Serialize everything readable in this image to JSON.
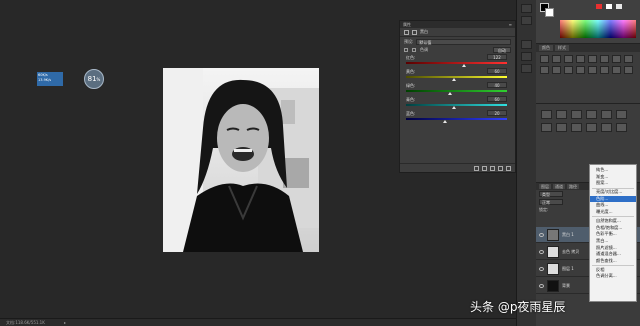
{
  "status_bar": {
    "doc_info": "文档:118.6K/551.1K",
    "arrow": "▸"
  },
  "properties_panel": {
    "title": "属性",
    "tab_label": "黑白",
    "preset_label": "预设:",
    "preset_value": "默认值",
    "tint_label": "色调",
    "auto_button": "自动",
    "sliders": [
      {
        "name": "红色:",
        "value": 122,
        "fraction": 0.5,
        "gradient": [
          "#5a0000",
          "#ff3030"
        ]
      },
      {
        "name": "黄色:",
        "value": 60,
        "fraction": 0.42,
        "gradient": [
          "#4d4d00",
          "#ffff30"
        ]
      },
      {
        "name": "绿色:",
        "value": 40,
        "fraction": 0.38,
        "gradient": [
          "#003f00",
          "#30d030"
        ]
      },
      {
        "name": "青色:",
        "value": 60,
        "fraction": 0.42,
        "gradient": [
          "#003f3f",
          "#30e0e0"
        ]
      },
      {
        "name": "蓝色:",
        "value": 20,
        "fraction": 0.34,
        "gradient": [
          "#00003f",
          "#3040ff"
        ]
      }
    ]
  },
  "color_panel": {
    "foreground": "#000000",
    "background": "#ffffff",
    "mini_swatches": [
      "#e83030",
      "#ffffff",
      "#e8e8e8"
    ]
  },
  "adjustments_panel": {
    "tabs": [
      "颜色",
      "样式"
    ]
  },
  "badge": {
    "value": "81",
    "unit": "%"
  },
  "tooltip": {
    "line1": "60K/s",
    "line2": "13.9K/s"
  },
  "layers_panel": {
    "tabs": [
      "图层",
      "通道",
      "路径"
    ],
    "mode": "正常",
    "lock_label": "锁定:",
    "kind": "类型",
    "rows": [
      {
        "name": "黑白 1",
        "thumb": "adj",
        "active": true
      },
      {
        "name": "去色 拷贝",
        "thumb": "photo",
        "active": false
      },
      {
        "name": "图层 1",
        "thumb": "photo",
        "active": false
      },
      {
        "name": "背景",
        "thumb": "dark",
        "active": false
      }
    ]
  },
  "context_menu": {
    "items": [
      {
        "label": "纯色...",
        "active": false
      },
      {
        "label": "渐变...",
        "active": false
      },
      {
        "label": "图案...",
        "active": false
      },
      {
        "sep": true
      },
      {
        "label": "亮度/对比度...",
        "active": false
      },
      {
        "label": "色阶...",
        "active": true
      },
      {
        "label": "曲线...",
        "active": false
      },
      {
        "label": "曝光度...",
        "active": false
      },
      {
        "sep": true
      },
      {
        "label": "自然饱和度...",
        "active": false
      },
      {
        "label": "色相/饱和度...",
        "active": false
      },
      {
        "label": "色彩平衡...",
        "active": false
      },
      {
        "label": "黑白...",
        "active": false
      },
      {
        "label": "照片滤镜...",
        "active": false
      },
      {
        "label": "通道混合器...",
        "active": false
      },
      {
        "label": "颜色查找...",
        "active": false
      },
      {
        "sep": true
      },
      {
        "label": "反相",
        "active": false
      },
      {
        "label": "色调分离...",
        "active": false
      }
    ]
  },
  "watermark": {
    "text": "头条 @p夜雨星辰"
  }
}
